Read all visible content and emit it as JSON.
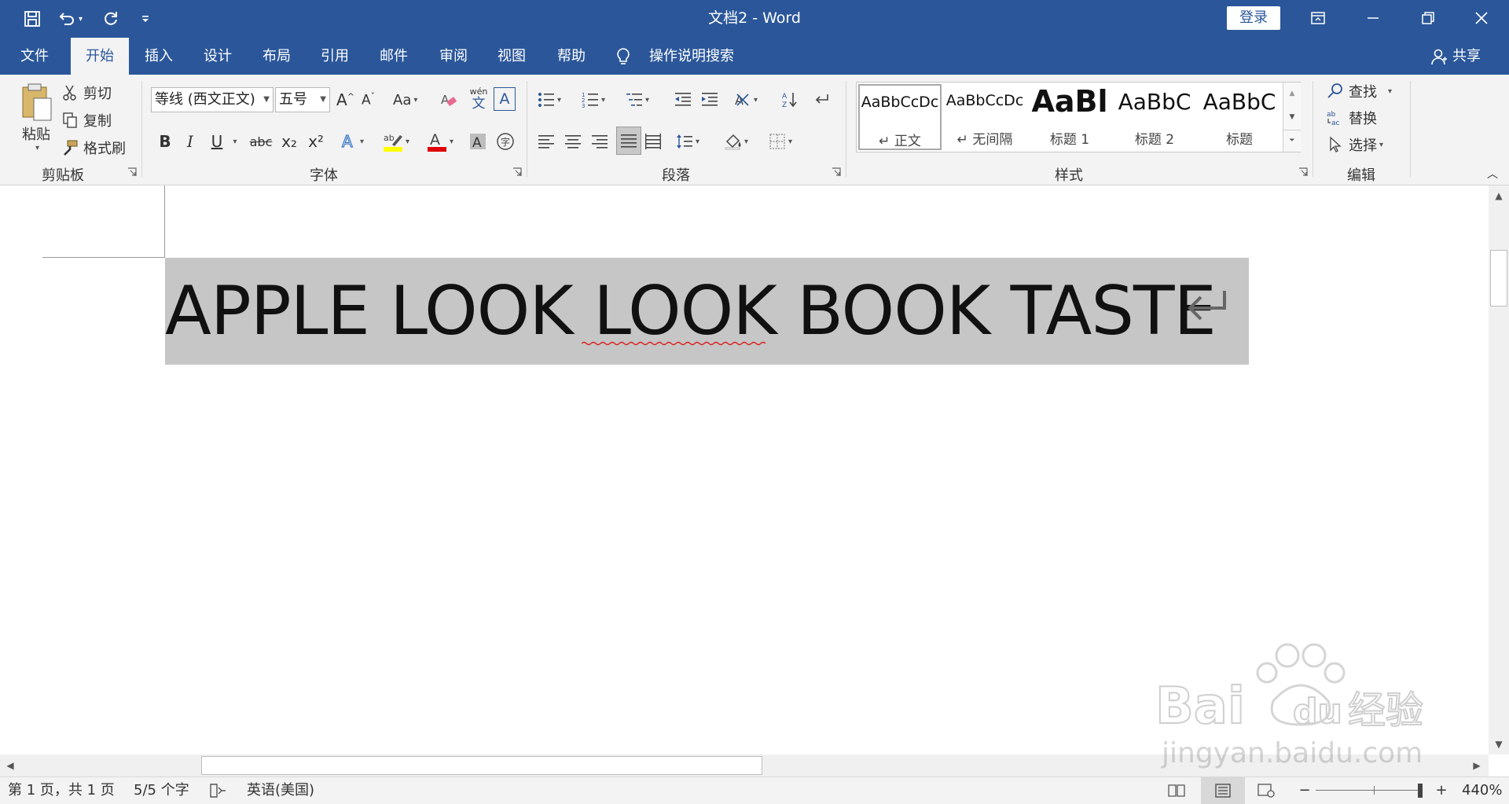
{
  "window": {
    "title": "文档2  -  Word",
    "login_label": "登录"
  },
  "tabs": [
    {
      "label": "文件"
    },
    {
      "label": "开始"
    },
    {
      "label": "插入"
    },
    {
      "label": "设计"
    },
    {
      "label": "布局"
    },
    {
      "label": "引用"
    },
    {
      "label": "邮件"
    },
    {
      "label": "审阅"
    },
    {
      "label": "视图"
    },
    {
      "label": "帮助"
    }
  ],
  "tell_me": "操作说明搜索",
  "share_label": "共享",
  "clipboard": {
    "paste": "粘贴",
    "cut": "剪切",
    "copy": "复制",
    "format_painter": "格式刷",
    "group": "剪贴板"
  },
  "font": {
    "name": "等线 (西文正文)",
    "size": "五号",
    "change_case": "Aa",
    "phonetic_top": "wén",
    "phonetic_bottom": "文",
    "border_char": "A",
    "bold": "B",
    "italic": "I",
    "underline": "U",
    "strike": "abc",
    "sub": "x₂",
    "sup": "x²",
    "group": "字体"
  },
  "paragraph": {
    "group": "段落"
  },
  "styles": {
    "group": "样式",
    "items": [
      {
        "sample": "AaBbCcDc",
        "name": "↵ 正文"
      },
      {
        "sample": "AaBbCcDc",
        "name": "↵ 无间隔"
      },
      {
        "sample": "AaBl",
        "name": "标题 1"
      },
      {
        "sample": "AaBbC",
        "name": "标题 2"
      },
      {
        "sample": "AaBbC",
        "name": "标题"
      }
    ]
  },
  "editing": {
    "find": "查找",
    "replace": "替换",
    "select": "选择",
    "group": "编辑"
  },
  "document": {
    "text": "APPLE LOOK LOOK BOOK TASTE"
  },
  "status": {
    "page": "第 1 页，共 1 页",
    "words": "5/5 个字",
    "language": "英语(美国)",
    "zoom": "440%",
    "zoom_minus": "−",
    "zoom_plus": "+"
  },
  "watermark": {
    "logo": "Bai du 经验",
    "url": "jingyan.baidu.com"
  },
  "colors": {
    "title_bar": "#2b579a",
    "ribbon": "#f3f3f3",
    "selection": "#c6c6c6",
    "highlight": "#ffff00",
    "font_color": "#e00000"
  }
}
